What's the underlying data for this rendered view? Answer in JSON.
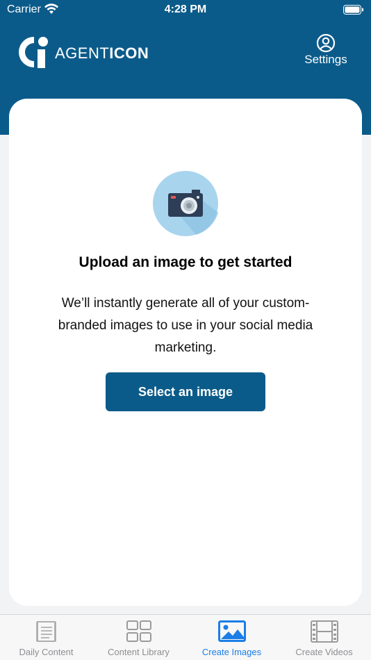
{
  "status_bar": {
    "carrier": "Carrier",
    "time": "4:28 PM"
  },
  "header": {
    "logo_agent": "AGENT",
    "logo_icon": "ICON",
    "settings_label": "Settings",
    "background_color": "#0b5b8a"
  },
  "card": {
    "title": "Upload an image to get started",
    "description": "We’ll instantly generate all of your custom-branded images to use in your social media marketing.",
    "button_label": "Select an image",
    "icon": "camera-icon"
  },
  "tabs": [
    {
      "label": "Daily Content",
      "icon": "daily-content-icon",
      "active": false
    },
    {
      "label": "Content Library",
      "icon": "grid-icon",
      "active": false
    },
    {
      "label": "Create Images",
      "icon": "image-icon",
      "active": true
    },
    {
      "label": "Create Videos",
      "icon": "film-icon",
      "active": false
    }
  ],
  "colors": {
    "accent": "#0b5b8a",
    "active_tab": "#1a7ee6",
    "inactive_tab": "#8e8e93"
  }
}
